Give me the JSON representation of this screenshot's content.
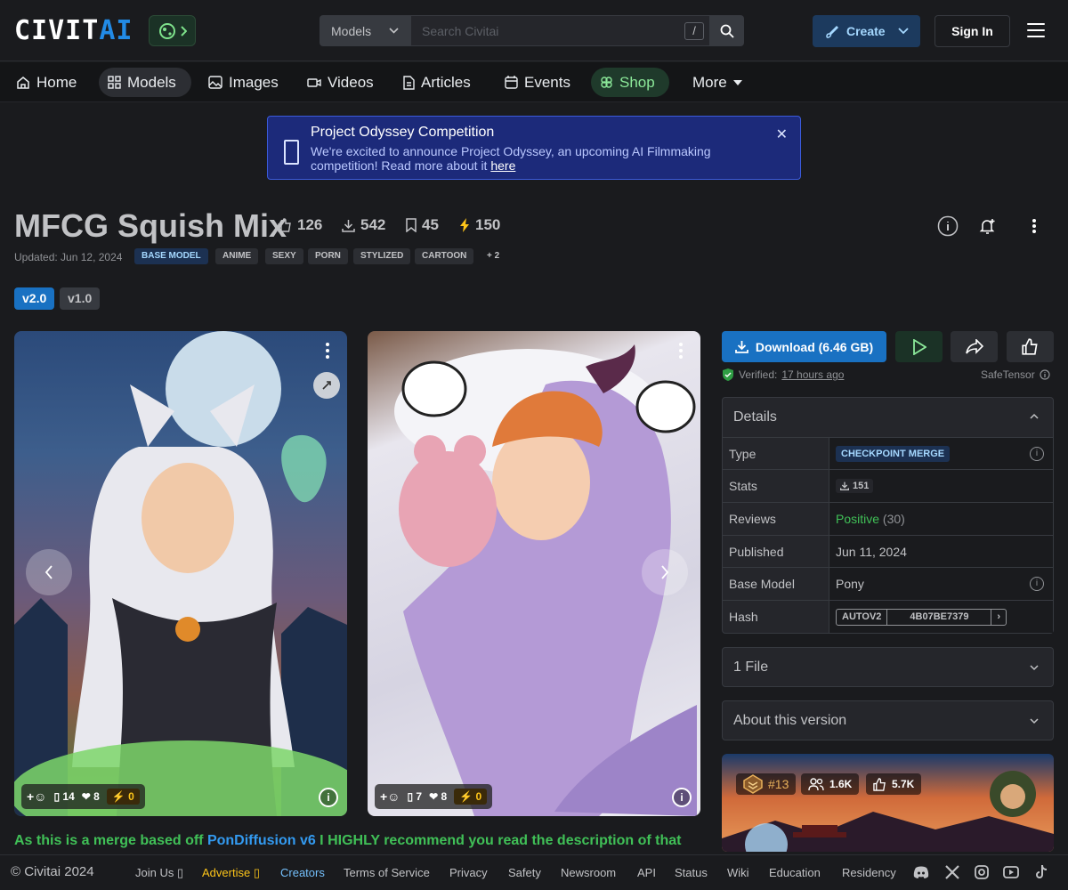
{
  "header": {
    "logo": {
      "left": "CIVIT",
      "right": "AI"
    },
    "search_type": "Models",
    "search_placeholder": "Search Civitai",
    "search_shortcut": "/",
    "create_label": "Create",
    "signin_label": "Sign In"
  },
  "nav": {
    "items": [
      {
        "label": "Home",
        "icon": "home-icon"
      },
      {
        "label": "Models",
        "icon": "grid-icon"
      },
      {
        "label": "Images",
        "icon": "photo-icon"
      },
      {
        "label": "Videos",
        "icon": "video-icon"
      },
      {
        "label": "Articles",
        "icon": "file-text-icon"
      },
      {
        "label": "Events",
        "icon": "calendar-icon"
      },
      {
        "label": "Shop",
        "icon": "clover-icon"
      },
      {
        "label": "More",
        "icon": "caret-down-icon"
      }
    ],
    "active": "Models"
  },
  "banner": {
    "title": "Project Odyssey Competition",
    "text": "We're excited to announce Project Odyssey, an upcoming AI Filmmaking competition! Read more about it",
    "link": "here"
  },
  "model": {
    "title": "MFCG Squish Mix",
    "stats": {
      "likes": "126",
      "downloads": "542",
      "bookmarks": "45",
      "buzz": "150"
    },
    "updated": "Updated: Jun 12, 2024",
    "base_tag": "BASE MODEL",
    "tags": [
      "ANIME",
      "SEXY",
      "PORN",
      "STYLIZED",
      "CARTOON",
      "+ 2"
    ],
    "versions": [
      "v2.0",
      "v1.0"
    ],
    "active_version": "v2.0"
  },
  "gallery": [
    {
      "comments": "14",
      "hearts": "8",
      "buzz": "0"
    },
    {
      "comments": "7",
      "hearts": "8",
      "buzz": "0"
    }
  ],
  "sidebar": {
    "download_label": "Download (6.46 GB)",
    "verified_label": "Verified:",
    "verified_time": "17 hours ago",
    "format": "SafeTensor",
    "details_title": "Details",
    "details": {
      "type_key": "Type",
      "type_value": "CHECKPOINT MERGE",
      "stats_key": "Stats",
      "stats_value": "151",
      "reviews_key": "Reviews",
      "reviews_value": "Positive",
      "reviews_count": "(30)",
      "published_key": "Published",
      "published_value": "Jun 11, 2024",
      "base_key": "Base Model",
      "base_value": "Pony",
      "hash_key": "Hash",
      "hash_type": "AUTOV2",
      "hash_value": "4B07BE7379"
    },
    "files_title": "1 File",
    "about_title": "About this version",
    "creator": {
      "rank": "#13",
      "followers": "1.6K",
      "likes": "5.7K"
    }
  },
  "description": {
    "pre": "As this is a merge based off ",
    "link": "PonDiffusion v6",
    "post": " I HIGHLY recommend you read the description of that"
  },
  "footer": {
    "copyright": "© Civitai 2024",
    "links": [
      "Join Us",
      "Advertise",
      "Creators",
      "Terms of Service",
      "Privacy",
      "Safety",
      "Newsroom",
      "API",
      "Status",
      "Wiki",
      "Education",
      "Residency"
    ]
  },
  "colors": {
    "accent": "#228be6",
    "download": "#1971c2",
    "positive": "#40c057",
    "advertise": "#fcc419"
  }
}
